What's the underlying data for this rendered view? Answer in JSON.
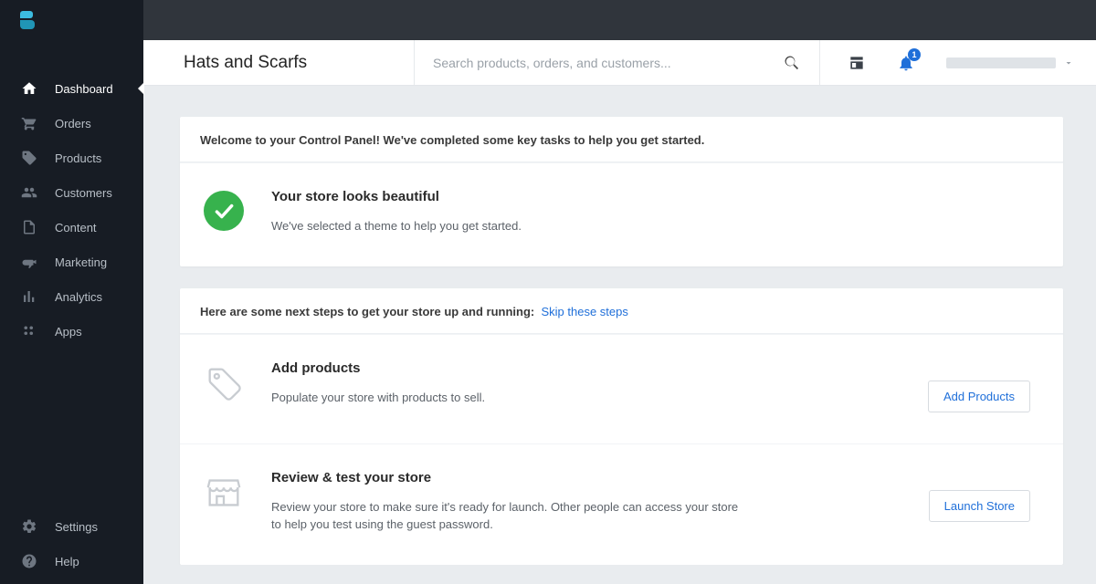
{
  "sidebar": {
    "items": [
      {
        "label": "Dashboard",
        "active": true
      },
      {
        "label": "Orders"
      },
      {
        "label": "Products"
      },
      {
        "label": "Customers"
      },
      {
        "label": "Content"
      },
      {
        "label": "Marketing"
      },
      {
        "label": "Analytics"
      },
      {
        "label": "Apps"
      }
    ],
    "bottom": [
      {
        "label": "Settings"
      },
      {
        "label": "Help"
      }
    ]
  },
  "header": {
    "store_name": "Hats and Scarfs",
    "search_placeholder": "Search products, orders, and customers...",
    "notification_count": "1"
  },
  "welcome_panel": {
    "heading": "Welcome to your Control Panel! We've completed some key tasks to help you get started.",
    "row_title": "Your store looks beautiful",
    "row_text": "We've selected a theme to help you get started."
  },
  "next_steps_panel": {
    "heading": "Here are some next steps to get your store up and running:",
    "skip_label": "Skip these steps",
    "rows": [
      {
        "title": "Add products",
        "text": "Populate your store with products to sell.",
        "button": "Add Products"
      },
      {
        "title": "Review & test your store",
        "text": "Review your store to make sure it's ready for launch. Other people can access your store to help you test using the guest password.",
        "button": "Launch Store"
      }
    ]
  }
}
